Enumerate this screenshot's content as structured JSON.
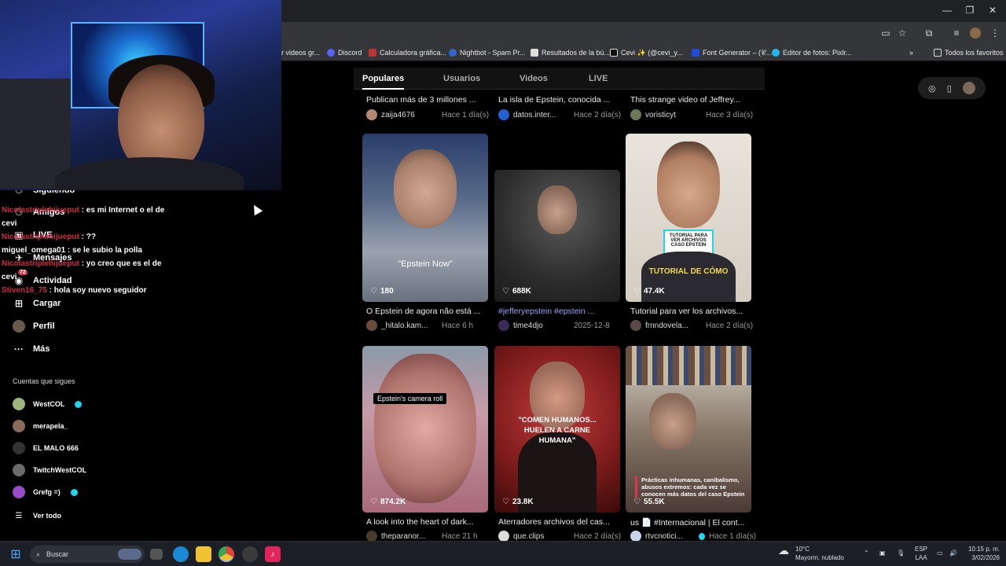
{
  "bookmarks": [
    {
      "label": "r videos gr...",
      "color": "#777777"
    },
    {
      "label": "Discord",
      "color": "#5865f2"
    },
    {
      "label": "Calculadora gráfica...",
      "color": "#c03434"
    },
    {
      "label": "Nightbot - Spam Pr...",
      "color": "#3366cc"
    },
    {
      "label": "Resultados de la bú...",
      "color": "#dddddd"
    },
    {
      "label": "Cevi ✨ (@cevi_y...",
      "color": "#111111"
    },
    {
      "label": "Font Generator – (𝒞...",
      "color": "#1f4fd6"
    },
    {
      "label": "Editor de fotos: Pixlr...",
      "color": "#21b6e8"
    }
  ],
  "bookmarks_all": "Todos los favoritos",
  "tabs": [
    "Populares",
    "Usuarios",
    "Videos",
    "LIVE"
  ],
  "sidebar": {
    "items": [
      {
        "label": "Siguiendo",
        "icon": "following-icon"
      },
      {
        "label": "Amigos",
        "icon": "friends-icon"
      },
      {
        "label": "LIVE",
        "icon": "live-icon"
      },
      {
        "label": "Mensajes",
        "icon": "messages-icon"
      },
      {
        "label": "Actividad",
        "icon": "activity-icon",
        "badge": "72"
      },
      {
        "label": "Cargar",
        "icon": "upload-icon"
      },
      {
        "label": "Perfil",
        "icon": "profile-icon"
      },
      {
        "label": "Más",
        "icon": "more-icon"
      }
    ],
    "following_title": "Cuentas que sigues",
    "following": [
      {
        "name": "WestCOL",
        "verified": true,
        "color": "#9bb57a"
      },
      {
        "name": "merapela_",
        "verified": false,
        "color": "#8a6a5a"
      },
      {
        "name": "EL MALO 666",
        "verified": false,
        "color": "#333333"
      },
      {
        "name": "TwitchWestCOL",
        "verified": false,
        "color": "#6a6a6a"
      },
      {
        "name": "Grefg =)",
        "verified": true,
        "color": "#9a4cc8"
      }
    ],
    "see_all": "Ver todo"
  },
  "chat": [
    {
      "user": "Nicolastriplehijueput",
      "msg": "es mi Internet o el de cevi"
    },
    {
      "user": "Nicolastriplehijueput",
      "msg": "??"
    },
    {
      "user": "miguel_omega01",
      "msg": "se le subio la polla"
    },
    {
      "user": "Nicolastriplehijueput",
      "msg": "yo creo que es el de cevi"
    },
    {
      "user": "Stiven16_75",
      "msg": "hola soy nuevo seguidor"
    }
  ],
  "top_row": [
    {
      "title": "Publican más de 3 millones ...",
      "author": "zaija4676",
      "date": "Hace 1 día(s)"
    },
    {
      "title": "La isla de Epstein, conocida ...",
      "author": "datos.inter...",
      "date": "Hace 2 día(s)"
    },
    {
      "title": "This strange video of Jeffrey...",
      "author": "voristicyt",
      "date": "Hace 3 día(s)"
    }
  ],
  "row1": [
    {
      "likes": "180",
      "overlay": "\"Epstein Now\"",
      "title": "O Epstein de agora não está ...",
      "author": "_hitalo.kam...",
      "date": "Hace 6 h"
    },
    {
      "likes": "688K",
      "overlay": "",
      "title": "#jefferyepstein #epstein ...",
      "author": "time4djo",
      "date": "2025-12-8"
    },
    {
      "likes": "47.4K",
      "overlay": "TUTORIAL DE CÓMO",
      "sign": "TUTORIAL PARA VER ARCHIVOS CASO EPSTEIN",
      "title": "Tutorial para ver los archivos...",
      "author": "frnndovela...",
      "date": "Hace 2 día(s)"
    }
  ],
  "row2": [
    {
      "likes": "874.2K",
      "overlay": "Epstein's camera roll",
      "title": "A look into the heart of dark...",
      "author": "theparanor...",
      "date": "Hace 21 h"
    },
    {
      "likes": "23.8K",
      "overlay": "\"COMEN HUMANOS... HUELEN A CARNE HUMANA\"",
      "title": "Aterradores archivos del cas...",
      "author": "que.clips",
      "date": "Hace 2 día(s)"
    },
    {
      "likes": "55.5K",
      "overlay": "Prácticas inhumanas, canibalismo, abusos extremos: cada vez se conocen más datos del caso Epstein",
      "title": "us 📄 #Internacional | El cont...",
      "author": "rtvcnotici...",
      "date": "Hace 1 día(s)"
    }
  ],
  "taskbar": {
    "search": "Buscar",
    "weather_temp": "10°C",
    "weather_desc": "Mayorm. nublado",
    "lang1": "ESP",
    "lang2": "LAA",
    "time": "10:15 p. m.",
    "date": "3/02/2026"
  }
}
